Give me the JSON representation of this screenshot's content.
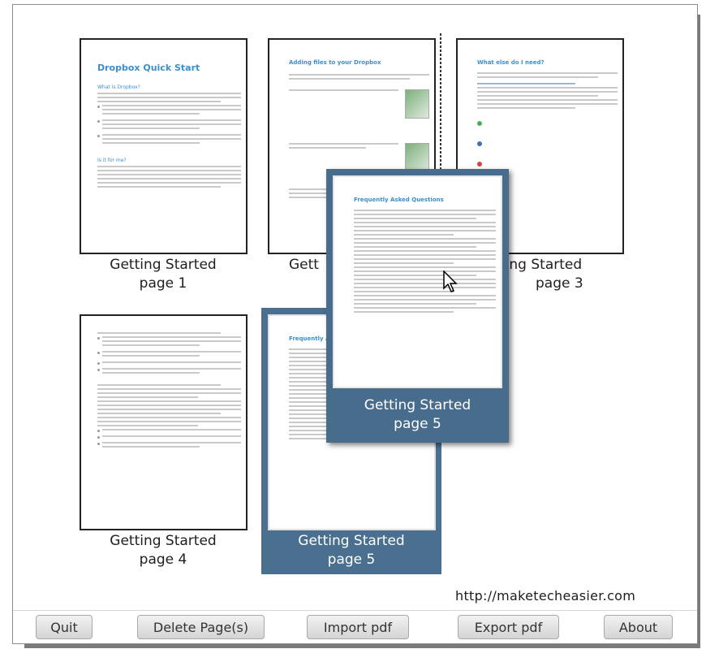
{
  "window": {
    "pages": [
      {
        "caption": "Getting Started\npage 1",
        "title": "Dropbox Quick Start",
        "section1": "What is Dropbox?",
        "section2": "Is it for me?"
      },
      {
        "caption": "Getting Started\npage 2",
        "title": "Adding files to your Dropbox"
      },
      {
        "caption": "Getting Started\npage 3",
        "title": "What else do I need?"
      },
      {
        "caption": "Getting Started\npage 4"
      },
      {
        "caption": "Getting Started\npage 5",
        "title": "Frequently Asked Questions"
      }
    ],
    "visible_captions": {
      "p1_line1": "Getting Started",
      "p1_line2": "page 1",
      "p2_line1": "Gett",
      "p3_line1": "ting Started",
      "p3_line2": "page 3",
      "p4_line1": "Getting Started",
      "p4_line2": "page 4",
      "p5_line1": "Getting Started",
      "p5_line2": "page 5",
      "drag_line1": "Getting Started",
      "drag_line2": "page 5"
    },
    "doc_titles": {
      "p1": "Dropbox Quick Start",
      "p1_sec1": "What is Dropbox?",
      "p1_sec2": "Is it for me?",
      "p2": "Adding files to your Dropbox",
      "p3": "What else do I need?",
      "p5": "Frequently Asked Questions",
      "drag": "Frequently Asked Questions"
    },
    "watermark": "http://maketecheasier.com"
  },
  "buttons": {
    "quit": "Quit",
    "delete": "Delete Page(s)",
    "import": "Import pdf",
    "export": "Export pdf",
    "about": "About"
  },
  "colors": {
    "selection": "#4a6f8f",
    "doc_heading": "#3a8fd0"
  },
  "icons": [
    "mouse-pointer-icon"
  ]
}
